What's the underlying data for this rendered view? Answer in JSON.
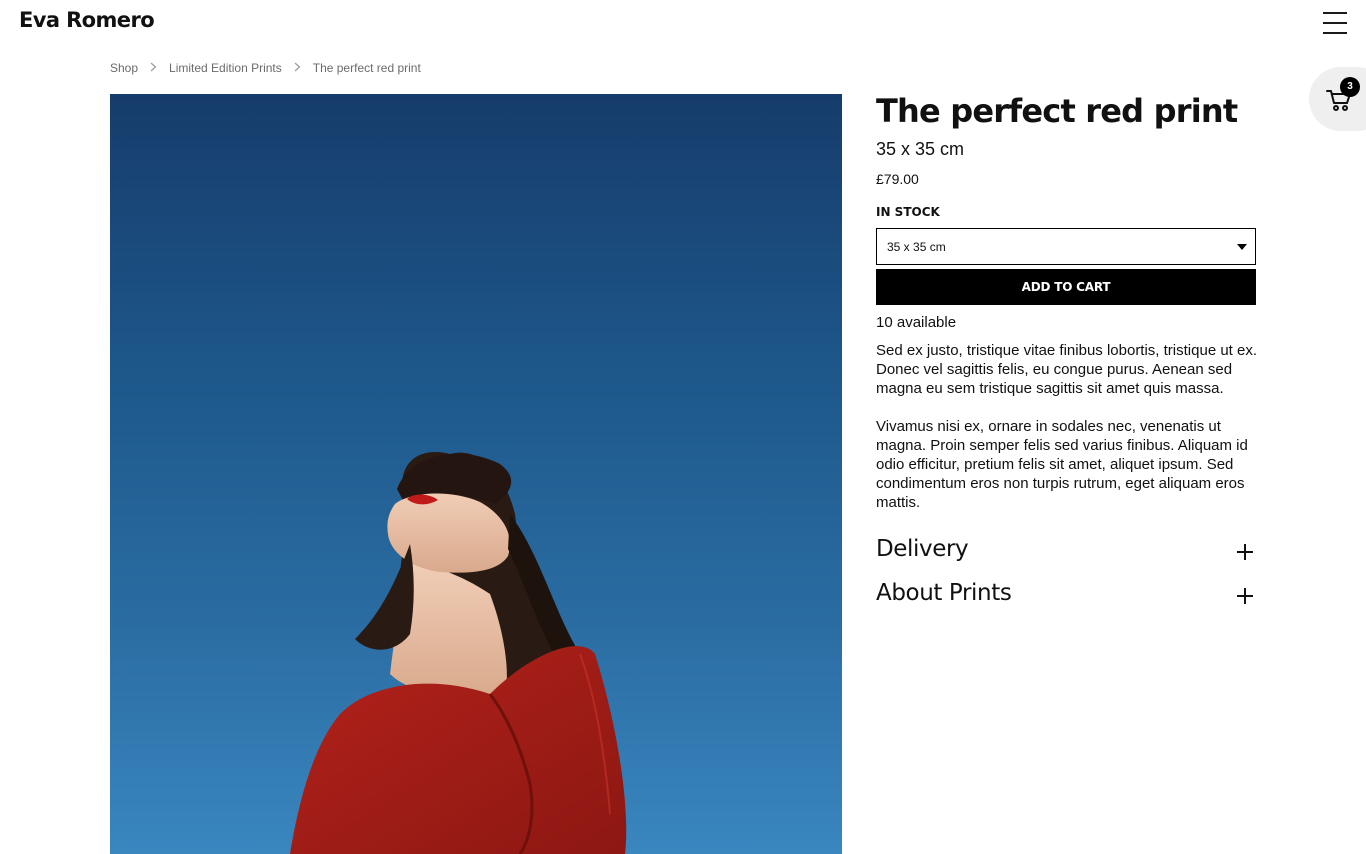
{
  "header": {
    "brand": "Eva Romero",
    "menu_icon": "hamburger-menu-icon"
  },
  "breadcrumb": {
    "items": [
      "Shop",
      "Limited Edition Prints",
      "The perfect red print"
    ],
    "separator_icon": "chevron-right-icon"
  },
  "cart": {
    "icon": "cart-icon",
    "count": "3"
  },
  "product": {
    "image_alt": "woman-in-red-dress-against-blue-sky",
    "title": "The perfect red print",
    "size": "35 x 35 cm",
    "price": "£79.00",
    "stock_label": "IN STOCK",
    "size_select": {
      "value": "35 x 35 cm",
      "icon": "caret-down-icon"
    },
    "add_to_cart_label": "ADD TO CART",
    "available": "10 available",
    "description": [
      "Sed ex justo, tristique vitae finibus lobortis, tristique ut ex. Donec vel sagittis felis, eu congue purus. Aenean sed magna eu sem tristique sagittis sit amet quis massa.",
      "Vivamus nisi ex, ornare in sodales nec, venenatis ut magna. Proin semper felis sed varius finibus. Aliquam id odio efficitur, pretium felis sit amet, aliquet ipsum. Sed condimentum eros non turpis rutrum, eget aliquam eros mattis."
    ],
    "accordions": [
      {
        "label": "Delivery",
        "icon": "plus-icon"
      },
      {
        "label": "About Prints",
        "icon": "plus-icon"
      }
    ]
  },
  "colors": {
    "sky_top": "#163c6b",
    "sky_bottom": "#3a86bf",
    "dress_red": "#a21c17",
    "button_bg": "#000000",
    "cart_bubble_bg": "#efefef"
  }
}
